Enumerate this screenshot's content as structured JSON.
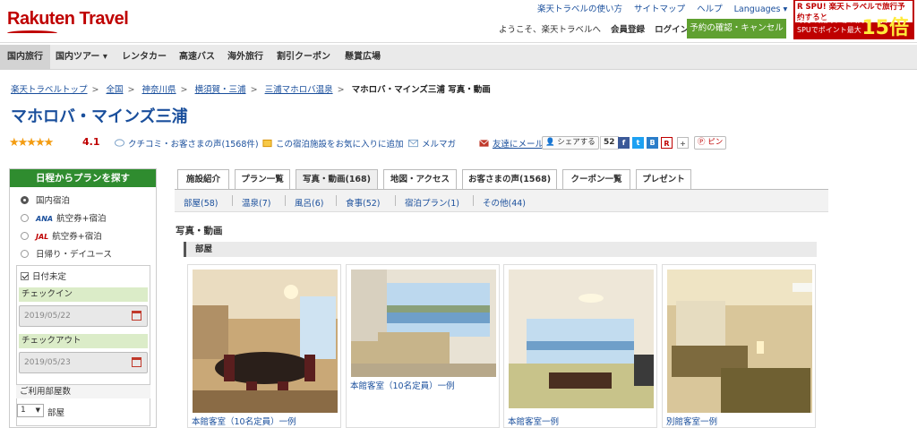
{
  "header": {
    "logo": "Rakuten Travel",
    "top_links": [
      "楽天トラベルの使い方",
      "サイトマップ",
      "ヘルプ",
      "Languages ▾"
    ],
    "welcome": "ようこそ、楽天トラベルへ",
    "member_register": "会員登録",
    "login": "ログイン",
    "reservation_button": "予約の確認・キャンセル",
    "spu_banner": {
      "line1": "R SPU! 楽天トラベルで旅行予約すると",
      "line2": "今月の楽天市場のお買い物が",
      "line3": "SPUでポイント最大",
      "big": "15倍"
    }
  },
  "nav": {
    "items": [
      "国内旅行",
      "国内ツアー ▾",
      "レンタカー",
      "高速バス",
      "海外旅行",
      "割引クーポン",
      "懸賞広場"
    ]
  },
  "breadcrumb": [
    "楽天トラベルトップ",
    "全国",
    "神奈川県",
    "横須賀・三浦",
    "三浦マホロバ温泉"
  ],
  "breadcrumb_current": "マホロバ・マインズ三浦 写真・動画",
  "breadcrumb_separator": ">",
  "hotel": {
    "name": "マホロバ・マインズ三浦",
    "rating": "4.1",
    "stars": "★★★★★",
    "review_link": "クチコミ・お客さまの声(1568件)",
    "favorite_link": "この宿泊施設をお気に入りに追加",
    "mailmag_link": "メルマガ",
    "mail_friend_link": "友達にメール",
    "share_button": "シェアする",
    "share_count": "52",
    "pin_button": "ピン"
  },
  "sidebar": {
    "title": "日程からプランを探す",
    "options": [
      "国内宿泊",
      "航空券+宿泊",
      "航空券+宿泊",
      "日帰り・デイユース"
    ],
    "ana_label": "ANA",
    "jal_label": "JAL",
    "date_undecided": "日付未定",
    "checkin_label": "チェックイン",
    "checkin_value": "2019/05/22",
    "checkout_label": "チェックアウト",
    "checkout_value": "2019/05/23",
    "rooms_label": "ご利用部屋数",
    "rooms_value": "1",
    "rooms_unit": "部屋"
  },
  "tabs": [
    "施設紹介",
    "プラン一覧",
    "写真・動画(168)",
    "地図・アクセス",
    "お客さまの声(1568)",
    "クーポン一覧",
    "プレゼント"
  ],
  "subtabs": [
    "部屋(58)",
    "温泉(7)",
    "風呂(6)",
    "食事(52)",
    "宿泊プラン(1)",
    "その他(44)"
  ],
  "section_title": "写真・動画",
  "category_heading": "部屋",
  "photos": [
    {
      "caption": "本館客室（10名定員）一例"
    },
    {
      "caption": "本館客室（10名定員）一例"
    },
    {
      "caption": "本館客室一例"
    },
    {
      "caption": "別館客室一例"
    }
  ],
  "colors": {
    "brand_red": "#bf0000",
    "link_blue": "#1a4f9c",
    "green_button": "#5fa030",
    "sidebar_header_green": "#2f8c2f"
  }
}
